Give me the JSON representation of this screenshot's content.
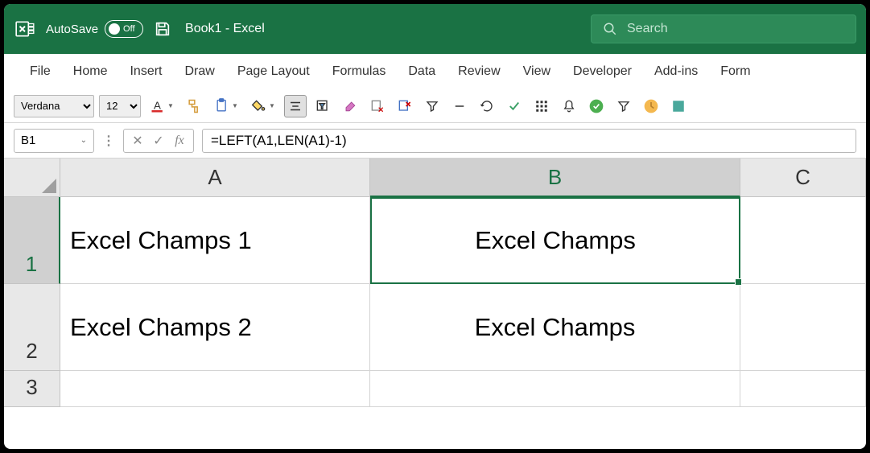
{
  "titlebar": {
    "autosave_label": "AutoSave",
    "autosave_state": "Off",
    "doc_title": "Book1  -  Excel"
  },
  "search": {
    "placeholder": "Search"
  },
  "ribbon": {
    "tabs": [
      "File",
      "Home",
      "Insert",
      "Draw",
      "Page Layout",
      "Formulas",
      "Data",
      "Review",
      "View",
      "Developer",
      "Add-ins",
      "Form"
    ]
  },
  "toolbar": {
    "font_name": "Verdana",
    "font_size": "12"
  },
  "formula_bar": {
    "name_box": "B1",
    "formula": "=LEFT(A1,LEN(A1)-1)"
  },
  "grid": {
    "columns": [
      "A",
      "B",
      "C"
    ],
    "rows": [
      "1",
      "2",
      "3"
    ],
    "selected_cell": "B1",
    "data": {
      "A1": "Excel Champs 1",
      "B1": "Excel Champs",
      "A2": "Excel Champs 2",
      "B2": "Excel Champs"
    }
  },
  "colors": {
    "excel_green": "#1a7244"
  }
}
